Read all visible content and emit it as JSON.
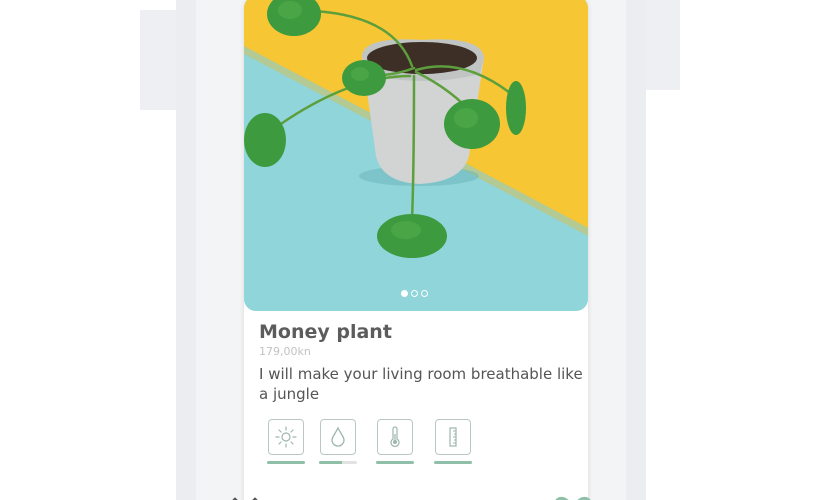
{
  "plant": {
    "name": "Money plant",
    "price": "179,00kn",
    "description": "I will make your living room breathable like a jungle"
  },
  "carousel": {
    "total": 3,
    "active_index": 0
  },
  "care_levels": [
    {
      "icon": "sun-icon",
      "level": 1.0
    },
    {
      "icon": "water-drop-icon",
      "level": 0.6
    },
    {
      "icon": "thermometer-icon",
      "level": 1.0
    },
    {
      "icon": "ruler-icon",
      "level": 1.0
    }
  ],
  "actions": {
    "dislike_icon": "dislike-icon",
    "like_icon": "heart-icon"
  },
  "colors": {
    "accent_green": "#8fbfa8",
    "photo_yellow": "#f6c634",
    "photo_cyan": "#8fd5d9"
  }
}
